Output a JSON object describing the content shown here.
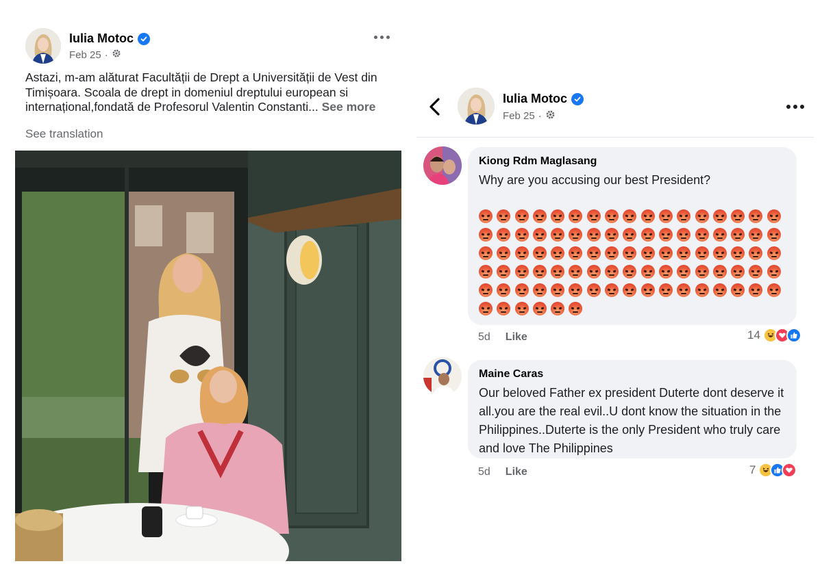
{
  "post": {
    "author": "Iulia Motoc",
    "date": "Feb 25",
    "text_line1": "Astazi, m-am alăturat Facultății de Drept a Universității de Vest din",
    "text_line2": "Timișoara. Scoala de drept in domeniul dreptului european si",
    "text_line3": "internațional,fondată de Profesorul Valentin Constanti...",
    "see_more": "See more",
    "see_translation": "See translation"
  },
  "comments_header": {
    "author": "Iulia Motoc",
    "date": "Feb 25"
  },
  "comments": [
    {
      "author": "Kiong Rdm Maglasang",
      "text": "Why are you accusing our best President?",
      "angry_emoji_count": 91,
      "time": "5d",
      "like_label": "Like",
      "reaction_count": "14"
    },
    {
      "author": "Maine Caras",
      "text": "Our beloved Father  ex president Duterte dont deserve it all.you are the real evil..U dont know the situation in the Philippines..Duterte is the only President who truly care and love The Philippines",
      "time": "5d",
      "like_label": "Like",
      "reaction_count": "7"
    }
  ],
  "icons": {
    "verified": "verified-badge-icon",
    "privacy": "gear-icon",
    "more": "more-options-icon",
    "back": "chevron-left-icon",
    "angry": "angry-emoji-icon",
    "haha": "haha-reaction-icon",
    "love": "love-reaction-icon",
    "like": "like-reaction-icon"
  },
  "colors": {
    "facebook_blue": "#1877f2",
    "secondary_text": "#65676b",
    "bubble_bg": "#f0f2f5"
  }
}
